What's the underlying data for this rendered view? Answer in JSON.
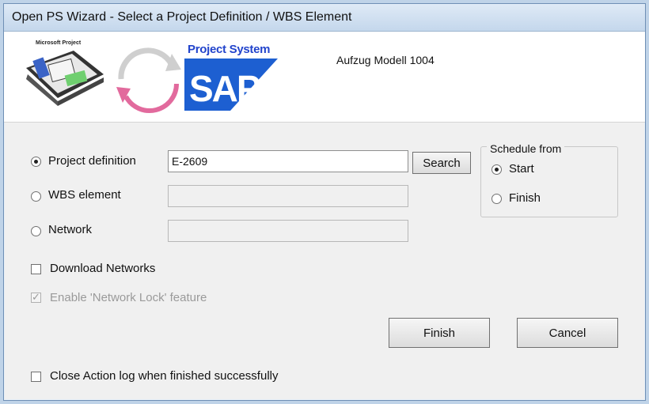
{
  "window": {
    "title": "Open PS Wizard - Select a Project Definition / WBS Element"
  },
  "banner": {
    "brand_small": "Microsoft Project",
    "product_label": "Project System",
    "logo_text": "SAP",
    "project_name": "Aufzug Modell 1004"
  },
  "selection": {
    "project_definition": {
      "label": "Project definition",
      "value": "E-2609",
      "checked": true
    },
    "wbs_element": {
      "label": "WBS element",
      "value": "",
      "checked": false
    },
    "network": {
      "label": "Network",
      "value": "",
      "checked": false
    }
  },
  "search_label": "Search",
  "schedule": {
    "legend": "Schedule from",
    "start_label": "Start",
    "finish_label": "Finish",
    "selected": "Start"
  },
  "options": {
    "download_networks": "Download Networks",
    "network_lock": "Enable 'Network Lock' feature",
    "close_action_log": "Close Action log when finished successfully"
  },
  "buttons": {
    "finish": "Finish",
    "cancel": "Cancel"
  },
  "colors": {
    "sap_blue": "#1d5fd1",
    "accent_pink": "#e0508a"
  }
}
